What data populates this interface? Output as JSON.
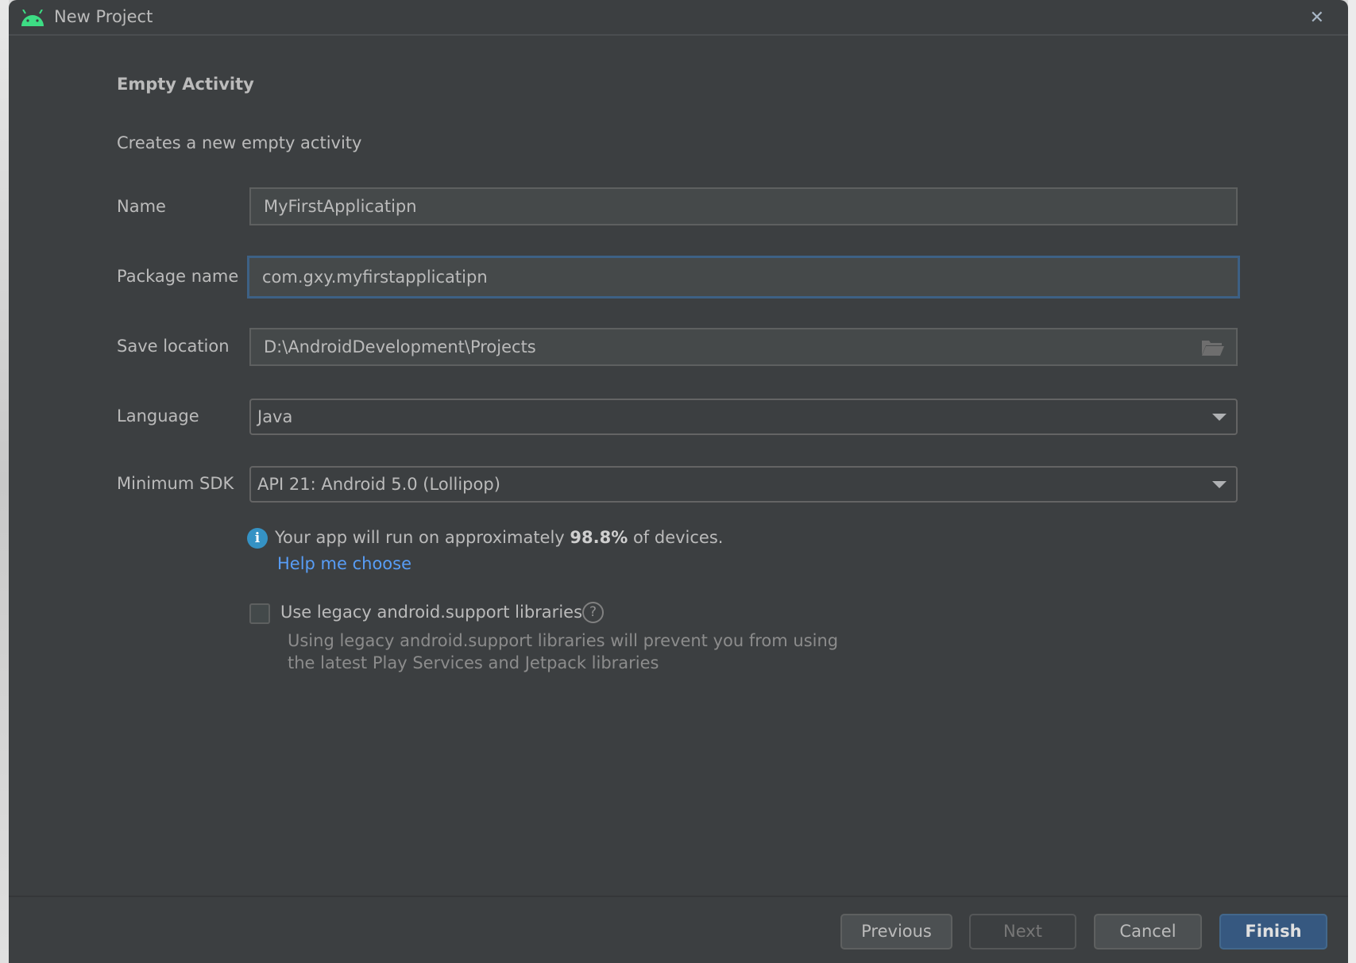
{
  "window": {
    "title": "New Project",
    "logo_icon": "android-icon",
    "close_icon": "close-icon"
  },
  "header": {
    "template_title": "Empty Activity",
    "description": "Creates a new empty activity"
  },
  "form": {
    "name": {
      "label": "Name",
      "value": "MyFirstApplicatipn"
    },
    "package": {
      "label": "Package name",
      "value": "com.gxy.myfirstapplicatipn"
    },
    "save_location": {
      "label": "Save location",
      "value": "D:\\AndroidDevelopment\\Projects",
      "icon": "folder-open-icon"
    },
    "language": {
      "label": "Language",
      "value": "Java"
    },
    "min_sdk": {
      "label": "Minimum SDK",
      "value": "API 21: Android 5.0 (Lollipop)"
    }
  },
  "info": {
    "prefix": "Your app will run on approximately ",
    "percent": "98.8%",
    "suffix": " of devices.",
    "help_link": "Help me choose"
  },
  "legacy": {
    "label": "Use legacy android.support libraries",
    "checked": false,
    "hint_line1": "Using legacy android.support libraries will prevent you from using",
    "hint_line2": "the latest Play Services and Jetpack libraries"
  },
  "buttons": {
    "previous": "Previous",
    "next": "Next",
    "cancel": "Cancel",
    "finish": "Finish"
  },
  "colors": {
    "background": "#3c3f41",
    "accent": "#365880",
    "link": "#589df6",
    "android_green": "#3ddc84"
  }
}
